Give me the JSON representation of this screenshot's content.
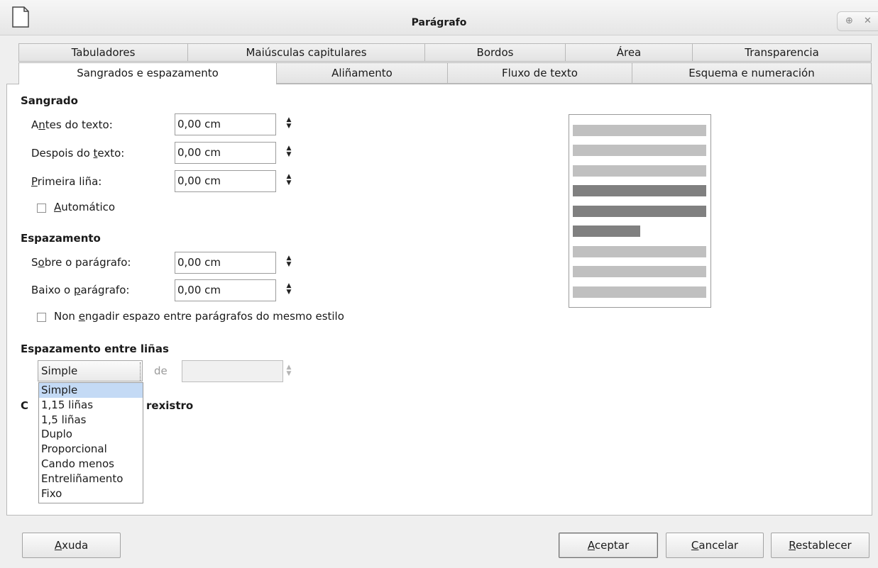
{
  "window": {
    "title": "Parágrafo",
    "icon": "document-icon"
  },
  "tabs_row1": [
    "Tabuladores",
    "Maiúsculas capitulares",
    "Bordos",
    "Área",
    "Transparencia"
  ],
  "tabs_row2": [
    "Sangrados e espazamento",
    "Aliñamento",
    "Fluxo de texto",
    "Esquema e numeración"
  ],
  "active_tab": "Sangrados e espazamento",
  "indent": {
    "heading": "Sangrado",
    "before_text": {
      "pre": "A",
      "u": "n",
      "post": "tes do texto:",
      "value": "0,00 cm"
    },
    "after_text": {
      "pre": "Despois do ",
      "u": "t",
      "post": "exto:",
      "value": "0,00 cm"
    },
    "first_line": {
      "pre": "",
      "u": "P",
      "post": "rimeira liña:",
      "value": "0,00 cm"
    },
    "automatic": {
      "pre": "",
      "u": "A",
      "post": "utomático",
      "checked": false
    }
  },
  "spacing": {
    "heading": "Espazamento",
    "above": {
      "pre": "S",
      "u": "o",
      "post": "bre o parágrafo:",
      "value": "0,00 cm"
    },
    "below": {
      "pre": "Baixo o ",
      "u": "p",
      "post": "arágrafo:",
      "value": "0,00 cm"
    },
    "no_space": {
      "pre": "Non ",
      "u": "e",
      "post": "ngadir espazo entre parágrafos do mesmo estilo",
      "checked": false
    }
  },
  "line_spacing": {
    "heading": "Espazamento entre liñas",
    "selected": "Simple",
    "of_label": "de",
    "of_value": "",
    "options": [
      "Simple",
      "1,15 liñas",
      "1,5 liñas",
      "Duplo",
      "Proporcional",
      "Cando menos",
      "Entreliñamento",
      "Fixo"
    ]
  },
  "register": {
    "heading_start": "C",
    "heading_end": "rexistro"
  },
  "preview": {
    "light_color": "#c0c0c0",
    "dark_color": "#808080"
  },
  "buttons": {
    "help": {
      "u": "A",
      "post": "xuda"
    },
    "ok": {
      "u": "A",
      "post": "ceptar"
    },
    "cancel": {
      "u": "C",
      "post": "ancelar"
    },
    "reset": {
      "u": "R",
      "post": "establecer"
    }
  }
}
